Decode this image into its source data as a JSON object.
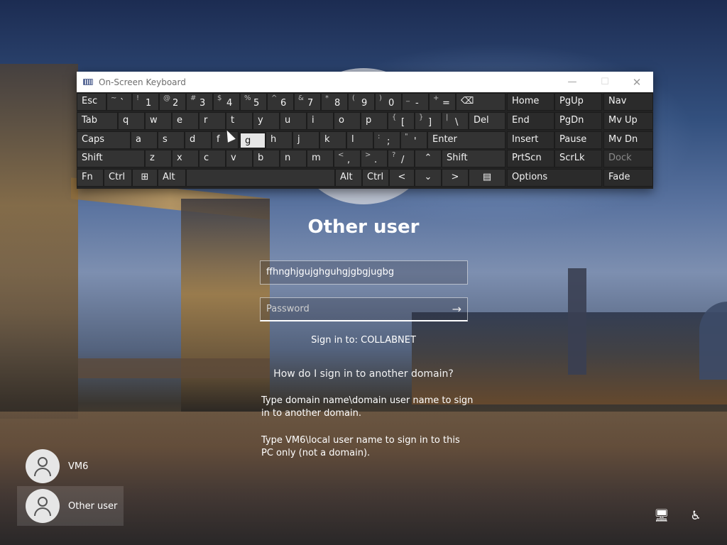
{
  "osk": {
    "title": "On-Screen Keyboard",
    "keys": {
      "esc": "Esc",
      "backspace": "⌫",
      "tab": "Tab",
      "del": "Del",
      "caps": "Caps",
      "enter": "Enter",
      "shift_left": "Shift",
      "shift_right": "Shift",
      "fn": "Fn",
      "ctrl_left": "Ctrl",
      "alt_left": "Alt",
      "alt_right": "Alt",
      "ctrl_right": "Ctrl",
      "home": "Home",
      "pgup": "PgUp",
      "nav": "Nav",
      "end": "End",
      "pgdn": "PgDn",
      "mvup": "Mv Up",
      "insert": "Insert",
      "pause": "Pause",
      "mvdn": "Mv Dn",
      "prtscn": "PrtScn",
      "scrlk": "ScrLk",
      "dock": "Dock",
      "options": "Options",
      "fade": "Fade",
      "q": "q",
      "w": "w",
      "e": "e",
      "r": "r",
      "t": "t",
      "y": "y",
      "u": "u",
      "i": "i",
      "o": "o",
      "p": "p",
      "a": "a",
      "s": "s",
      "d": "d",
      "f": "f",
      "g": "g",
      "h": "h",
      "j": "j",
      "k": "k",
      "l": "l",
      "z": "z",
      "x": "x",
      "c": "c",
      "v": "v",
      "b": "b",
      "n": "n",
      "m": "m"
    },
    "number_row": [
      {
        "shift": "~",
        "main": "`"
      },
      {
        "shift": "!",
        "main": "1"
      },
      {
        "shift": "@",
        "main": "2"
      },
      {
        "shift": "#",
        "main": "3"
      },
      {
        "shift": "$",
        "main": "4"
      },
      {
        "shift": "%",
        "main": "5"
      },
      {
        "shift": "^",
        "main": "6"
      },
      {
        "shift": "&",
        "main": "7"
      },
      {
        "shift": "*",
        "main": "8"
      },
      {
        "shift": "(",
        "main": "9"
      },
      {
        "shift": ")",
        "main": "0"
      },
      {
        "shift": "_",
        "main": "-"
      },
      {
        "shift": "+",
        "main": "="
      }
    ],
    "punct": [
      {
        "shift": "{",
        "main": "["
      },
      {
        "shift": "}",
        "main": "]"
      },
      {
        "shift": "|",
        "main": "\\"
      },
      {
        "shift": ":",
        "main": ";"
      },
      {
        "shift": "\"",
        "main": "'"
      },
      {
        "shift": "<",
        "main": ","
      },
      {
        "shift": ">",
        "main": "."
      },
      {
        "shift": "?",
        "main": "/"
      }
    ]
  },
  "login": {
    "title": "Other user",
    "username_value": "ffhnghjgujghguhgjgbgjugbg",
    "password_placeholder": "Password",
    "sign_in_to": "Sign in to: COLLABNET",
    "help_link": "How do I sign in to another domain?",
    "help_text_1": "Type domain name\\domain user name to sign in to another domain.",
    "help_text_2": "Type VM6\\local user name to sign in to this PC only (not a domain)."
  },
  "users": [
    {
      "name": "VM6"
    },
    {
      "name": "Other user"
    }
  ]
}
